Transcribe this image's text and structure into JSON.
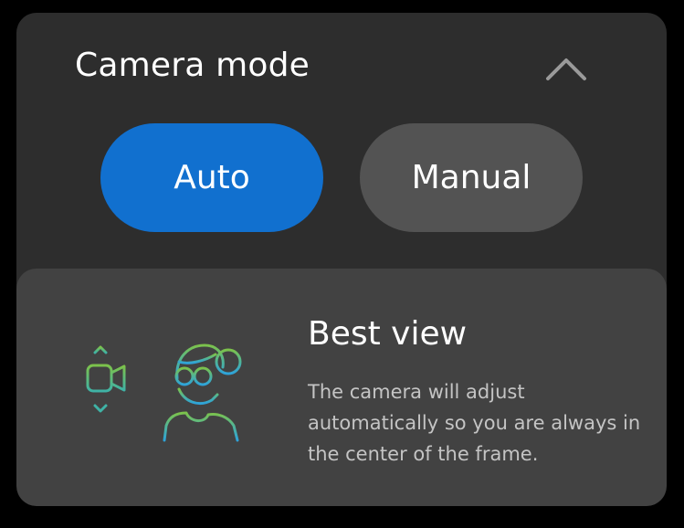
{
  "panel": {
    "title": "Camera mode",
    "collapse_icon": "chevron-up-icon"
  },
  "modes": {
    "auto_label": "Auto",
    "manual_label": "Manual",
    "selected": "Auto"
  },
  "best_view": {
    "title": "Best view",
    "description": "The camera will adjust automatically so you are always in the center of the frame.",
    "illustration_icons": [
      "camera-icon",
      "person-icon"
    ]
  },
  "colors": {
    "selected_button": "#1170cf",
    "unselected_button": "#535353",
    "panel_background": "#2d2d2d",
    "card_background": "#424242",
    "illustration_green": "#6cc04a",
    "illustration_blue": "#2ea3d9"
  }
}
